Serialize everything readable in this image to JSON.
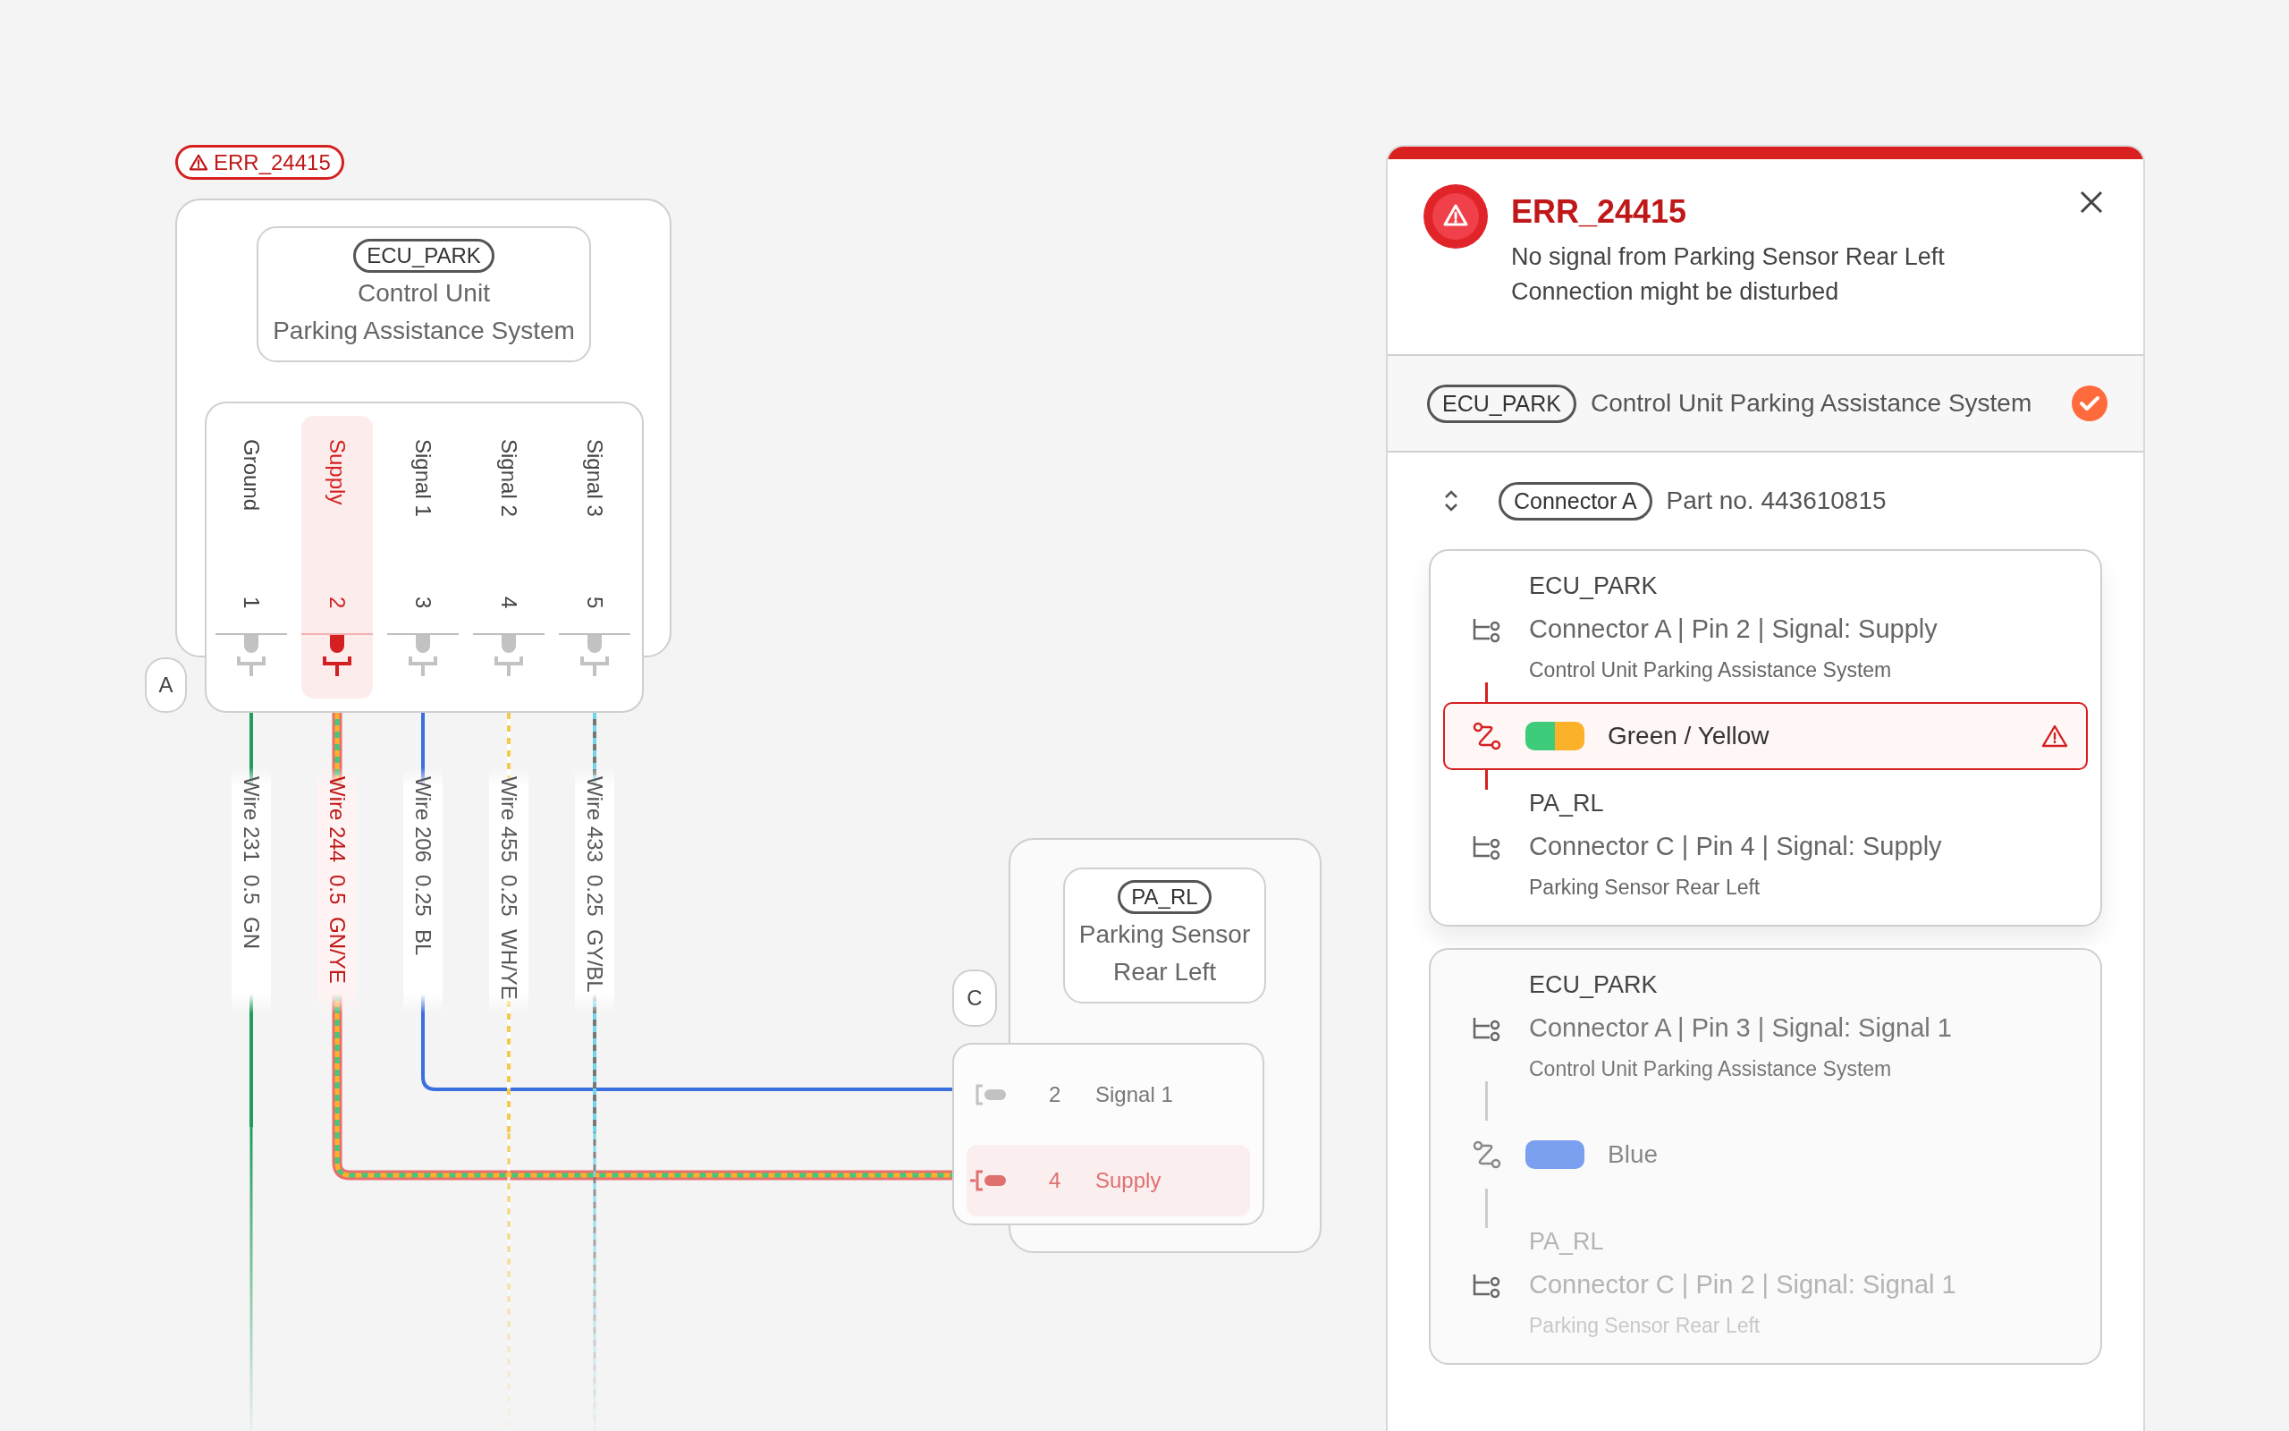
{
  "error_badge": {
    "code": "ERR_24415"
  },
  "ecu": {
    "tag": "ECU_PARK",
    "name_lines": [
      "Control Unit",
      "Parking Assistance System"
    ],
    "connector_label": "A",
    "pins": [
      {
        "name": "Ground",
        "number": "1",
        "selected": false,
        "wire": {
          "label": "Wire 231",
          "gauge": "0.5",
          "code": "GN",
          "kind": "open",
          "strands": [
            {
              "color": "#1f9d5c"
            }
          ]
        }
      },
      {
        "name": "Supply",
        "number": "2",
        "selected": true,
        "wire": {
          "label": "Wire 244",
          "gauge": "0.5",
          "code": "GN/YE",
          "kind": "connected",
          "strands": [
            {
              "color": "#3ecb7a"
            },
            {
              "color": "#fbb12a"
            }
          ]
        }
      },
      {
        "name": "Signal 1",
        "number": "3",
        "selected": false,
        "wire": {
          "label": "Wire 206",
          "gauge": "0.25",
          "code": "BL",
          "kind": "connected",
          "strands": [
            {
              "color": "#3b6fe0"
            }
          ]
        }
      },
      {
        "name": "Signal 2",
        "number": "4",
        "selected": false,
        "wire": {
          "label": "Wire 455",
          "gauge": "0.25",
          "code": "WH/YE",
          "kind": "open",
          "strands": [
            {
              "color": "#ffffff"
            },
            {
              "color": "#f7c948"
            }
          ]
        }
      },
      {
        "name": "Signal 3",
        "number": "5",
        "selected": false,
        "wire": {
          "label": "Wire 433",
          "gauge": "0.25",
          "code": "GY/BL",
          "kind": "open",
          "strands": [
            {
              "color": "#777777"
            },
            {
              "color": "#6fd6ea"
            }
          ]
        }
      }
    ]
  },
  "sensor": {
    "tag": "PA_RL",
    "name_lines": [
      "Parking Sensor",
      "Rear Left"
    ],
    "connector_label": "C",
    "pins": [
      {
        "number": "2",
        "name": "Signal 1",
        "selected": false
      },
      {
        "number": "4",
        "name": "Supply",
        "selected": true
      }
    ]
  },
  "panel": {
    "code": "ERR_24415",
    "message_lines": [
      "No signal from Parking Sensor Rear Left",
      "Connection might be disturbed"
    ],
    "component": {
      "tag": "ECU_PARK",
      "name": "Control Unit Parking Assistance System",
      "verified": true
    },
    "connector": {
      "tag": "Connector A",
      "part": "Part no. 443610815"
    },
    "connections": [
      {
        "selected": true,
        "from": {
          "device": "ECU_PARK",
          "detail": "Connector A | Pin 2 | Signal: Supply",
          "description": "Control Unit Parking Assistance System"
        },
        "wire": {
          "label": "Green / Yellow",
          "strands": [
            {
              "color": "#3ecb7a"
            },
            {
              "color": "#fbb12a"
            }
          ],
          "faulty": true
        },
        "to": {
          "device": "PA_RL",
          "detail": "Connector C | Pin 4 | Signal: Supply",
          "description": "Parking Sensor Rear Left"
        }
      },
      {
        "selected": false,
        "from": {
          "device": "ECU_PARK",
          "detail": "Connector A | Pin 3 | Signal: Signal 1",
          "description": "Control Unit Parking Assistance System"
        },
        "wire": {
          "label": "Blue",
          "strands": [
            {
              "color": "#7aa0ef"
            }
          ],
          "faulty": false
        },
        "to": {
          "device": "PA_RL",
          "detail": "Connector C | Pin 2 | Signal: Signal 1",
          "description": "Parking Sensor Rear Left"
        }
      }
    ]
  }
}
